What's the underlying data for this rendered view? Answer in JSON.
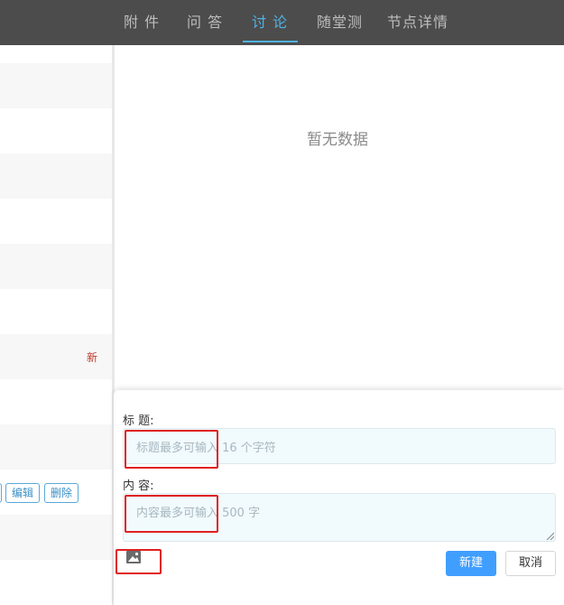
{
  "tabs": [
    {
      "label": "附 件",
      "active": false
    },
    {
      "label": "问 答",
      "active": false
    },
    {
      "label": "讨 论",
      "active": true
    },
    {
      "label": "随堂测",
      "active": false
    },
    {
      "label": "节点详情",
      "active": false
    }
  ],
  "left_list": {
    "new_mark": "新",
    "edit_label": "编辑",
    "delete_label": "删除"
  },
  "right": {
    "empty_text": "暂无数据"
  },
  "form": {
    "title_label": "标 题:",
    "title_placeholder": "标题最多可输入 16 个字符",
    "content_label": "内 容:",
    "content_placeholder": "内容最多可输入 500 字",
    "image_icon": "image-icon",
    "create_label": "新建",
    "cancel_label": "取消"
  },
  "colors": {
    "accent": "#409eff",
    "tab_active": "#4fb3e8",
    "highlight": "#e02020",
    "new_mark": "#c0392b"
  }
}
